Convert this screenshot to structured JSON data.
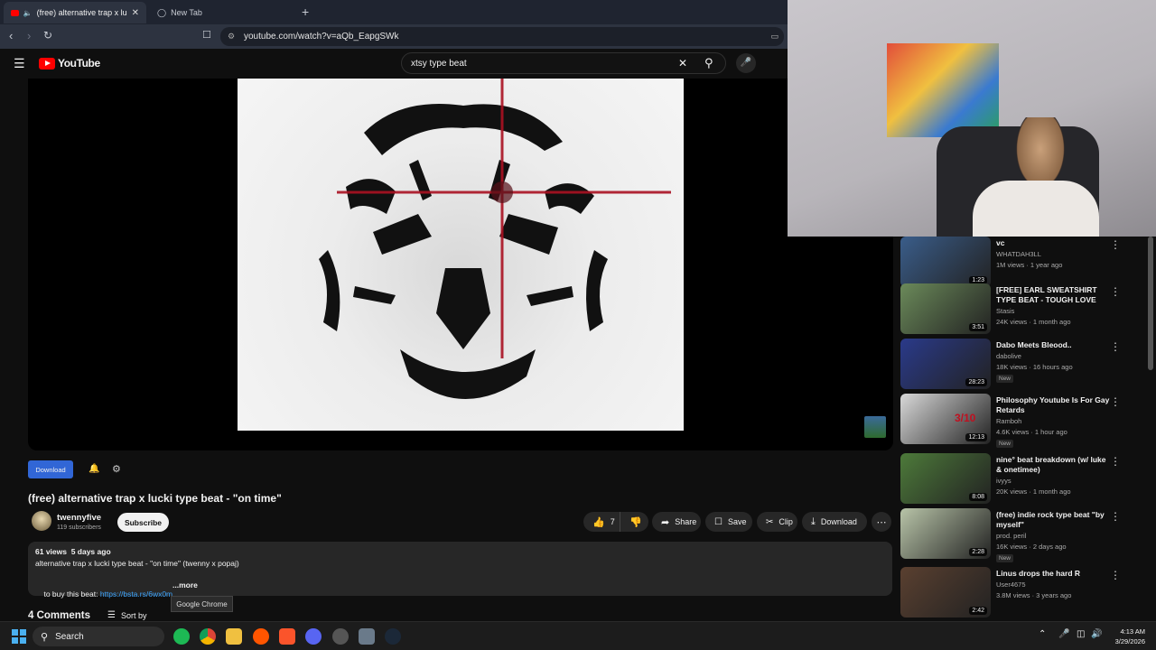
{
  "browser": {
    "tabs": [
      {
        "label": "(free) alternative trap x lucki t",
        "active": true
      },
      {
        "label": "New Tab",
        "active": false
      }
    ],
    "new_tab": "+",
    "url": "youtube.com/watch?v=aQb_EapgSWk"
  },
  "youtube": {
    "logo_text": "YouTube",
    "search_query": "xtsy type beat"
  },
  "video": {
    "download_ext_button": "Download",
    "title": "(free) alternative trap x lucki type beat - \"on time\"",
    "channel": "twennyfive",
    "subscribers": "119 subscribers",
    "subscribe_label": "Subscribe",
    "likes": "7",
    "share_label": "Share",
    "save_label": "Save",
    "clip_label": "Clip",
    "download_label": "Download",
    "views_date": "61 views  5 days ago",
    "description_line1": "alternative trap x lucki type beat - \"on time\" (twenny x popaj)",
    "buy_prefix": "to buy this beat: ",
    "buy_link": "https://bsta.rs/6wx0m",
    "more_label": "...more",
    "comments_label": "4 Comments",
    "sort_label": "Sort by",
    "tooltip": "Google Chrome"
  },
  "recommendations": [
    {
      "title": "vc",
      "channel": "WHATDAH3LL",
      "meta": "1M views · 1 year ago",
      "duration": "1:23",
      "new": false,
      "color": "#3a5d8a"
    },
    {
      "title": "[FREE] EARL SWEATSHIRT TYPE BEAT - TOUGH LOVE",
      "channel": "Stasis",
      "meta": "24K views · 1 month ago",
      "duration": "3:51",
      "new": false,
      "color": "#6b8a5a"
    },
    {
      "title": "Dabo Meets Bleood..",
      "channel": "dabolive",
      "meta": "18K views · 16 hours ago",
      "duration": "28:23",
      "new": true,
      "color": "#2a3a8a"
    },
    {
      "title": "Philosophy Youtube Is For Gay Retards",
      "channel": "Ramboh",
      "meta": "4.6K views · 1 hour ago",
      "duration": "12:13",
      "new": true,
      "color": "#d9d9d9",
      "overlay": "3/10"
    },
    {
      "title": "nine° beat breakdown (w/ luke & onetimee)",
      "channel": "ivyys",
      "meta": "20K views · 1 month ago",
      "duration": "8:08",
      "new": false,
      "color": "#4d7a3a"
    },
    {
      "title": "(free) indie rock type beat \"by myself\"",
      "channel": "prod. peril",
      "meta": "16K views · 2 days ago",
      "duration": "2:28",
      "new": true,
      "color": "#b8c4a8"
    },
    {
      "title": "Linus drops the hard R",
      "channel": "User4675",
      "meta": "3.8M views · 3 years ago",
      "duration": "2:42",
      "new": false,
      "color": "#5a4030"
    }
  ],
  "new_badge": "New",
  "taskbar": {
    "search_label": "Search",
    "time": "4:13 AM",
    "date": "3/29/2026"
  },
  "colors": {
    "youtube_red": "#ff0000",
    "ext_blue": "#3166d6",
    "link_blue": "#3ea6ff"
  }
}
